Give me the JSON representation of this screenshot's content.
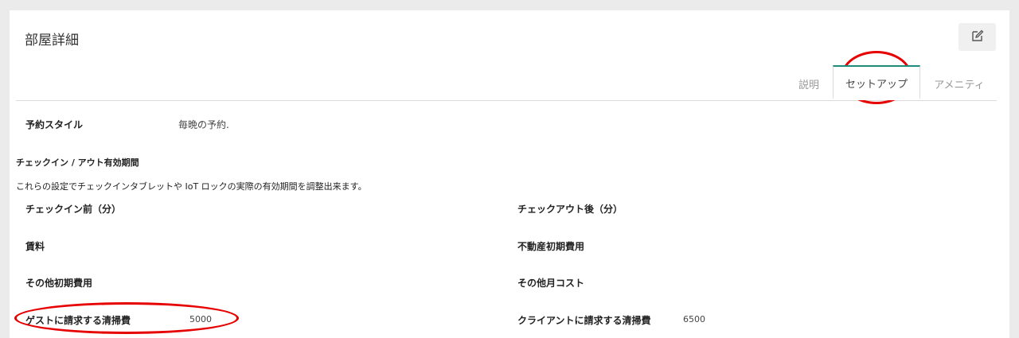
{
  "card": {
    "title": "部屋詳細"
  },
  "toolbar": {
    "edit_icon": "edit-icon"
  },
  "tabs": [
    {
      "label": "説明"
    },
    {
      "label": "セットアップ",
      "active": true
    },
    {
      "label": "アメニティ"
    }
  ],
  "reservation": {
    "label": "予約スタイル",
    "value": "毎晩の予約."
  },
  "checkin_section": {
    "heading": "チェックイン / アウト有効期間",
    "description": "これらの設定でチェックインタブレットや IoT ロックの実際の有効期間を調整出来ます。"
  },
  "fields": {
    "checkin_before": {
      "label": "チェックイン前（分）",
      "value": ""
    },
    "checkout_after": {
      "label": "チェックアウト後（分）",
      "value": ""
    },
    "rent": {
      "label": "賃料",
      "value": ""
    },
    "real_estate_initial": {
      "label": "不動産初期費用",
      "value": ""
    },
    "other_initial": {
      "label": "その他初期費用",
      "value": ""
    },
    "other_monthly": {
      "label": "その他月コスト",
      "value": ""
    },
    "guest_cleaning": {
      "label": "ゲストに請求する清掃費",
      "value": "5000"
    },
    "client_cleaning": {
      "label": "クライアントに請求する清掃費",
      "value": "6500"
    }
  },
  "colors": {
    "accent": "#1e8c7a",
    "annotation": "#e60000"
  }
}
